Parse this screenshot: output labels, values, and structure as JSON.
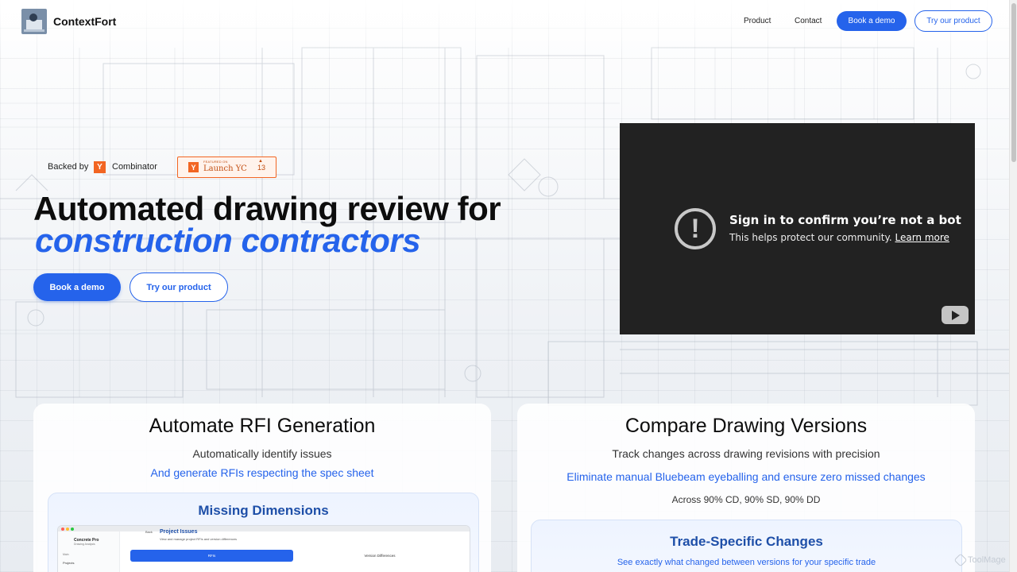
{
  "nav": {
    "brand": "ContextFort",
    "links": [
      "Product",
      "Contact"
    ],
    "book_demo": "Book a demo",
    "try_product": "Try our product"
  },
  "hero": {
    "backed_by": "Backed by",
    "yc_letter": "Y",
    "combinator": "Combinator",
    "launch_badge": {
      "small_text": "FEATURED ON",
      "text": "Launch YC",
      "count": "13"
    },
    "headline_line1": "Automated drawing review for",
    "headline_line2": "construction contractors",
    "book_demo": "Book a demo",
    "try_product": "Try our product"
  },
  "video": {
    "title": "Sign in to confirm you’re not a bot",
    "subtitle": "This helps protect our community.",
    "link": "Learn more"
  },
  "features": [
    {
      "title": "Automate RFI Generation",
      "subtitle": "Automatically identify issues",
      "subtitle_blue": "And generate RFIs respecting the spec sheet",
      "panel_title": "Missing Dimensions",
      "mini_app": {
        "app_name": "Concrete Pro",
        "app_desc": "Drawing Analysis",
        "section": "Main",
        "nav_item": "Projects",
        "back": "Back",
        "page_title": "Project Issues",
        "page_desc": "View and manage project RFIs and version differences",
        "tabs": [
          "RFIs",
          "Version Differences"
        ]
      }
    },
    {
      "title": "Compare Drawing Versions",
      "subtitle": "Track changes across drawing revisions with precision",
      "subtitle_blue": "Eliminate manual Bluebeam eyeballing and ensure zero missed changes",
      "note": "Across 90% CD, 90% SD, 90% DD",
      "panel_title": "Trade-Specific Changes",
      "panel_sub": "See exactly what changed between versions for your specific trade"
    }
  ],
  "watermark": "ToolMage",
  "colors": {
    "accent": "#2563eb",
    "yc_orange": "#f26522",
    "video_bg": "#222222"
  }
}
